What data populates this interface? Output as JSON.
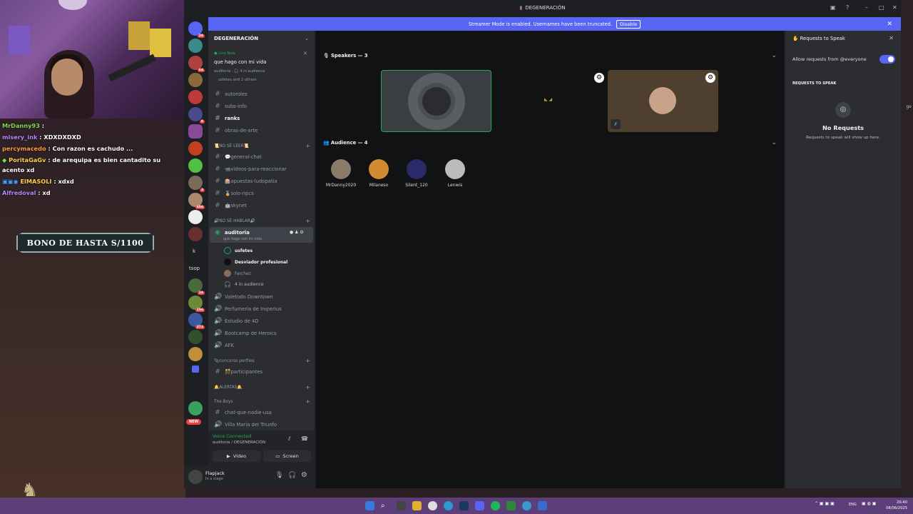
{
  "stream": {
    "chat": [
      {
        "user": "MrDanny93",
        "text": " : ",
        "color": "#7fdc4a"
      },
      {
        "user": "misery_ink",
        "text": " : XDXDXDXD",
        "color": "#b888ff"
      },
      {
        "user": "percymacedo",
        "text": " : Con razon es cachudo ...",
        "color": "#ff9a3c"
      },
      {
        "user": "PoritaGaGv",
        "text": " : de arequipa es bien cantadito su",
        "color": "#ffd24a"
      },
      {
        "user": "",
        "text": "acento xd",
        "color": "#ffffff"
      },
      {
        "user": "ElMASOLI",
        "text": " : xdxd",
        "color": "#ffd24a"
      },
      {
        "user": "Alfredoval",
        "text": " : xd",
        "color": "#b888ff"
      }
    ],
    "bonus_banner": "BONO DE HASTA S/1100"
  },
  "window": {
    "title": "DEGENERACIÓN",
    "streamer_banner": "Streamer Mode is enabled. Usernames have been truncated.",
    "disable_label": "Disable"
  },
  "guilds": {
    "badges": [
      "28",
      "64",
      "",
      "8",
      "",
      "",
      "",
      "",
      "",
      "",
      "3",
      "608",
      "",
      "",
      "",
      "",
      "19",
      "196",
      "373",
      "",
      "",
      "",
      "",
      "",
      "NEW"
    ],
    "text_items": [
      "k",
      "tsop"
    ]
  },
  "server": {
    "name": "DEGENERACIÓN",
    "live": {
      "label": "Live Now",
      "title": "que hago con mi vida",
      "meta": "auditoria · 🎧 4 in audience",
      "people": "usfetes and 2 others"
    },
    "channels_top": [
      "autoroles",
      "subs-info",
      "ranks",
      "obras-de-arte"
    ],
    "category1": "📜NO SÉ LEER📜",
    "channels_cat1": [
      "💬general-chat",
      "📹videos-para-reaccionar",
      "🎰apuestas-ludopatia",
      "🏅solo-npcs",
      "🤖skynet"
    ],
    "category2": "🔊NO SÉ HABLAR🔊",
    "stage": {
      "name": "auditoria",
      "topic": "que hago con mi vida"
    },
    "stage_members": [
      "usfetes",
      "Desviador profesional",
      "Farchez"
    ],
    "stage_audience": "4 in audience",
    "voice_channels": [
      "Valetodo Downtown",
      "Perfumeria de Imperius",
      "Estudio de 4D",
      "Bootcamp de Heroics",
      "AFK"
    ],
    "category3": "📎concurso perfiles",
    "channels_cat3": [
      "🎊participantes"
    ],
    "category4": "🔔ALERTAS🔔",
    "category5": "The Boys",
    "channels_cat5": [
      "chat-que-nadie-usa",
      "Villa María del Triunfo"
    ]
  },
  "voice": {
    "status": "Voice Connected",
    "location": "auditoria / DEGENERACIÓN",
    "video_label": "Video",
    "screen_label": "Screen"
  },
  "user": {
    "name": "Flapjack",
    "status": "In a stage"
  },
  "stage_view": {
    "speakers_label": "Speakers — 3",
    "audience_label": "Audience — 4",
    "audience": [
      "MrDanny2020",
      "Milaneso",
      "Silent_120",
      "Lenwis"
    ]
  },
  "requests": {
    "title": "Requests to Speak",
    "allow_label": "Allow requests from @everyone",
    "section": "REQUESTS TO SPEAK",
    "empty_title": "No Requests",
    "empty_sub": "Requests to speak will show up here."
  },
  "taskbar": {
    "lang": "ENG",
    "time": "20:40",
    "date": "08/06/2025"
  },
  "colors": {
    "blurple": "#5865f2",
    "green": "#23a55a",
    "taskbar": "#5c3f78"
  }
}
